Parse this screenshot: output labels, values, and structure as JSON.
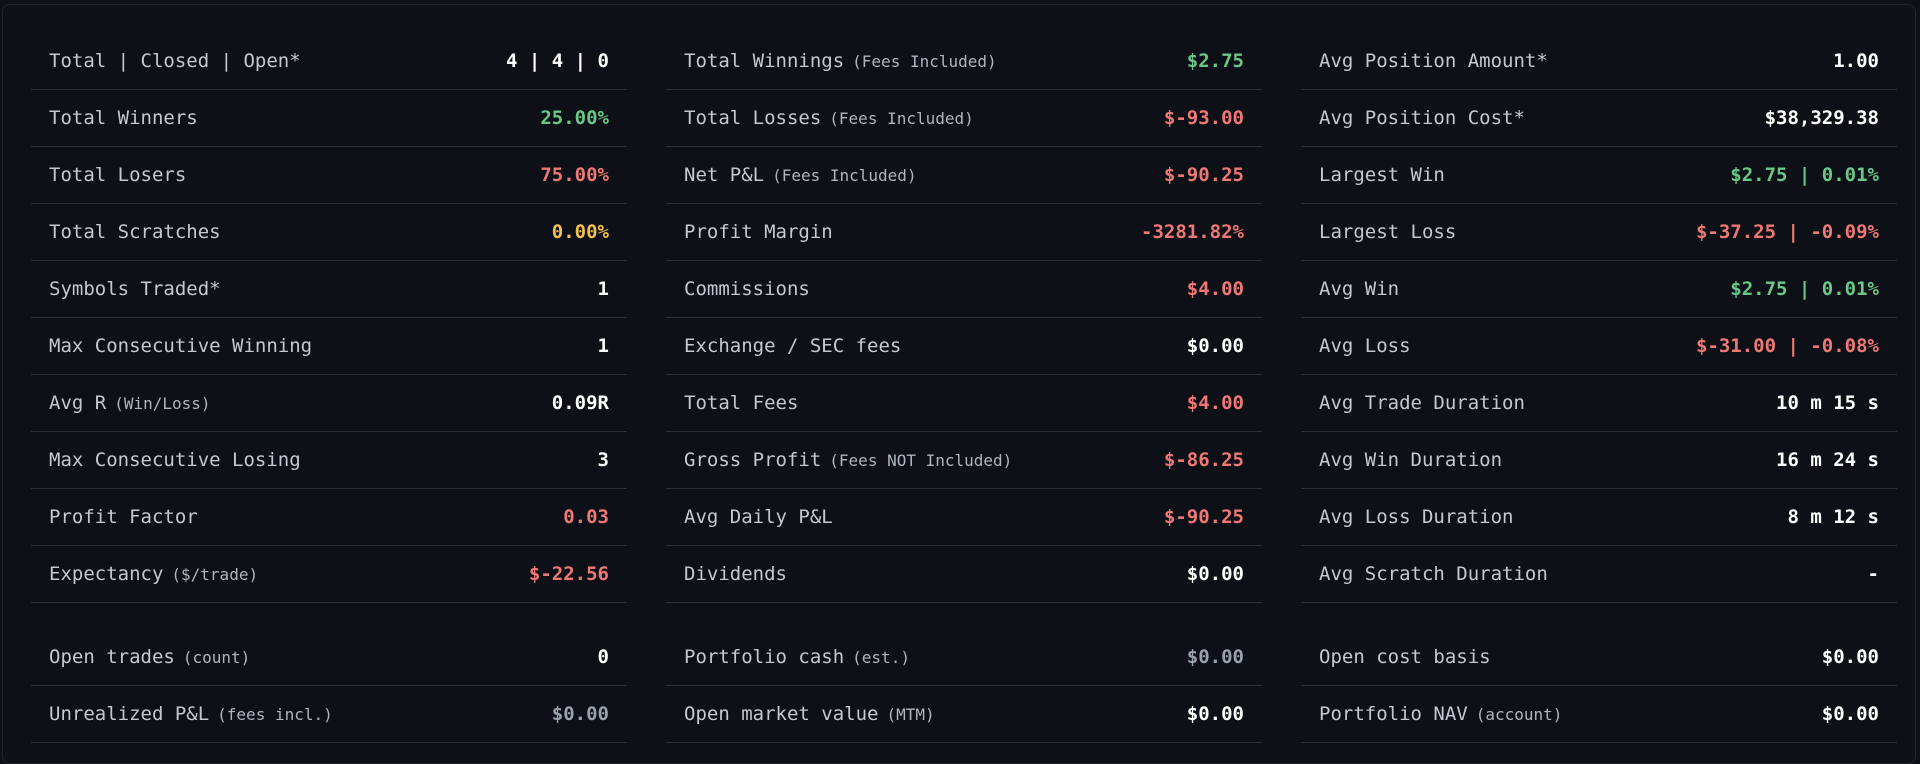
{
  "colors": {
    "background": "#0d1117",
    "label": "#c3c9d0",
    "positive": "#6bc788",
    "negative": "#f07874",
    "neutral": "#f2c14e",
    "muted": "#9aa2ab",
    "value": "#ffffff"
  },
  "columns": [
    {
      "rows": [
        {
          "label": "Total | Closed | Open*",
          "sub": "",
          "value": "4 | 4 | 0",
          "tone": "white"
        },
        {
          "label": "Total Winners",
          "sub": "",
          "value": "25.00%",
          "tone": "green"
        },
        {
          "label": "Total Losers",
          "sub": "",
          "value": "75.00%",
          "tone": "red"
        },
        {
          "label": "Total Scratches",
          "sub": "",
          "value": "0.00%",
          "tone": "yellow"
        },
        {
          "label": "Symbols Traded*",
          "sub": "",
          "value": "1",
          "tone": "white"
        },
        {
          "label": "Max Consecutive Winning",
          "sub": "",
          "value": "1",
          "tone": "white"
        },
        {
          "label": "Avg R",
          "sub": "(Win/Loss)",
          "value": "0.09R",
          "tone": "white"
        },
        {
          "label": "Max Consecutive Losing",
          "sub": "",
          "value": "3",
          "tone": "white"
        },
        {
          "label": "Profit Factor",
          "sub": "",
          "value": "0.03",
          "tone": "red"
        },
        {
          "label": "Expectancy",
          "sub": "($/trade)",
          "value": "$-22.56",
          "tone": "red"
        }
      ],
      "open_rows": [
        {
          "label": "Open trades",
          "sub": "(count)",
          "value": "0",
          "tone": "white"
        },
        {
          "label": "Unrealized P&L",
          "sub": "(fees incl.)",
          "value": "$0.00",
          "tone": "gray"
        }
      ]
    },
    {
      "rows": [
        {
          "label": "Total Winnings",
          "sub": "(Fees Included)",
          "value": "$2.75",
          "tone": "green"
        },
        {
          "label": "Total Losses",
          "sub": "(Fees Included)",
          "value": "$-93.00",
          "tone": "red"
        },
        {
          "label": "Net P&L",
          "sub": "(Fees Included)",
          "value": "$-90.25",
          "tone": "red"
        },
        {
          "label": "Profit Margin",
          "sub": "",
          "value": "-3281.82%",
          "tone": "red"
        },
        {
          "label": "Commissions",
          "sub": "",
          "value": "$4.00",
          "tone": "red"
        },
        {
          "label": "Exchange / SEC fees",
          "sub": "",
          "value": "$0.00",
          "tone": "white"
        },
        {
          "label": "Total Fees",
          "sub": "",
          "value": "$4.00",
          "tone": "red"
        },
        {
          "label": "Gross Profit",
          "sub": "(Fees NOT Included)",
          "value": "$-86.25",
          "tone": "red"
        },
        {
          "label": "Avg Daily P&L",
          "sub": "",
          "value": "$-90.25",
          "tone": "red"
        },
        {
          "label": "Dividends",
          "sub": "",
          "value": "$0.00",
          "tone": "white"
        }
      ],
      "open_rows": [
        {
          "label": "Portfolio cash",
          "sub": "(est.)",
          "value": "$0.00",
          "tone": "gray"
        },
        {
          "label": "Open market value",
          "sub": "(MTM)",
          "value": "$0.00",
          "tone": "white"
        }
      ]
    },
    {
      "rows": [
        {
          "label": "Avg Position Amount*",
          "sub": "",
          "value": "1.00",
          "tone": "white"
        },
        {
          "label": "Avg Position Cost*",
          "sub": "",
          "value": "$38,329.38",
          "tone": "white"
        },
        {
          "label": "Largest Win",
          "sub": "",
          "value": "$2.75 | 0.01%",
          "tone": "green"
        },
        {
          "label": "Largest Loss",
          "sub": "",
          "value": "$-37.25 | -0.09%",
          "tone": "red"
        },
        {
          "label": "Avg Win",
          "sub": "",
          "value": "$2.75 | 0.01%",
          "tone": "green"
        },
        {
          "label": "Avg Loss",
          "sub": "",
          "value": "$-31.00 | -0.08%",
          "tone": "red"
        },
        {
          "label": "Avg Trade Duration",
          "sub": "",
          "value": "10 m 15 s",
          "tone": "white"
        },
        {
          "label": "Avg Win Duration",
          "sub": "",
          "value": "16 m 24 s",
          "tone": "white"
        },
        {
          "label": "Avg Loss Duration",
          "sub": "",
          "value": "8 m 12 s",
          "tone": "white"
        },
        {
          "label": "Avg Scratch Duration",
          "sub": "",
          "value": "-",
          "tone": "white"
        }
      ],
      "open_rows": [
        {
          "label": "Open cost basis",
          "sub": "",
          "value": "$0.00",
          "tone": "white"
        },
        {
          "label": "Portfolio NAV",
          "sub": "(account)",
          "value": "$0.00",
          "tone": "white"
        }
      ]
    }
  ]
}
